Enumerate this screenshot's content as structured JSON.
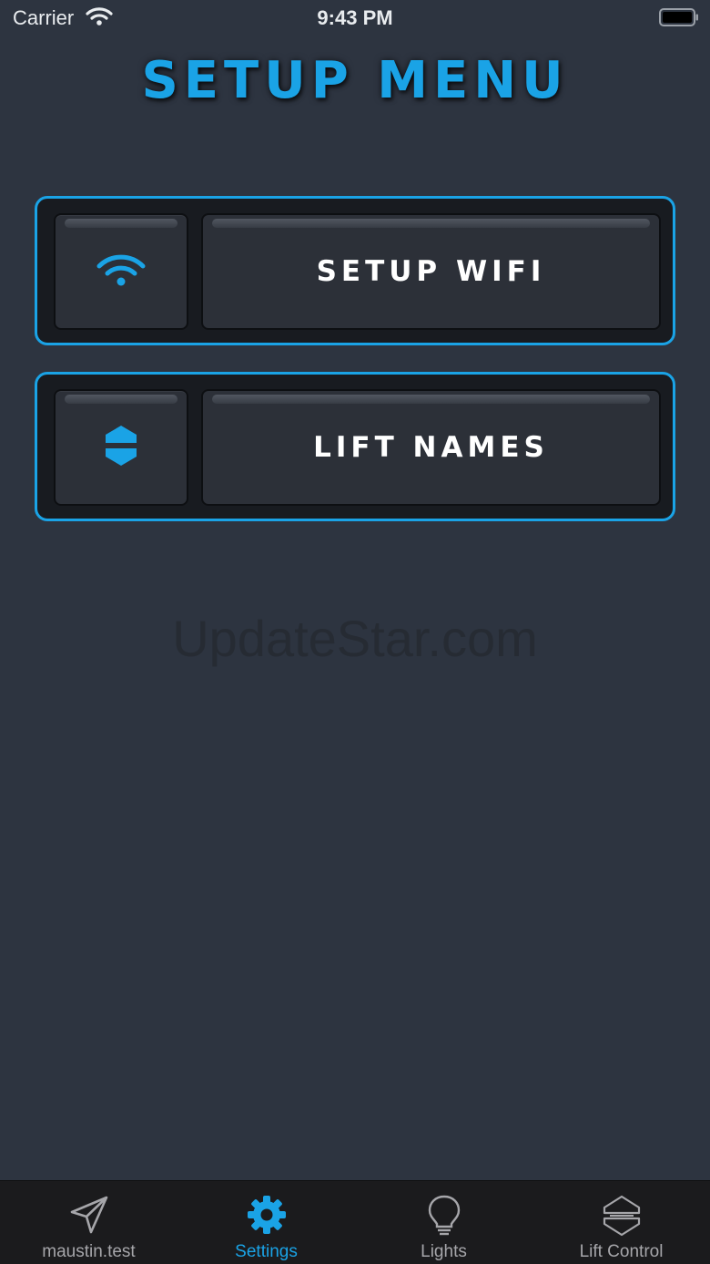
{
  "status_bar": {
    "carrier": "Carrier",
    "time": "9:43 PM"
  },
  "header": {
    "title": "SETUP MENU"
  },
  "menu": {
    "items": [
      {
        "label": "SETUP WIFI",
        "icon": "wifi-icon"
      },
      {
        "label": "LIFT NAMES",
        "icon": "lift-icon"
      }
    ]
  },
  "watermark": "UpdateStar.com",
  "tab_bar": {
    "tabs": [
      {
        "label": "maustin.test",
        "icon": "paper-plane-icon",
        "active": false
      },
      {
        "label": "Settings",
        "icon": "gear-icon",
        "active": true
      },
      {
        "label": "Lights",
        "icon": "lightbulb-icon",
        "active": false
      },
      {
        "label": "Lift Control",
        "icon": "lift-control-icon",
        "active": false
      }
    ]
  },
  "colors": {
    "accent": "#1aa3e6",
    "background": "#2d3440",
    "tab_bar": "#1b1b1d",
    "tab_inactive": "#a6a6aa"
  }
}
